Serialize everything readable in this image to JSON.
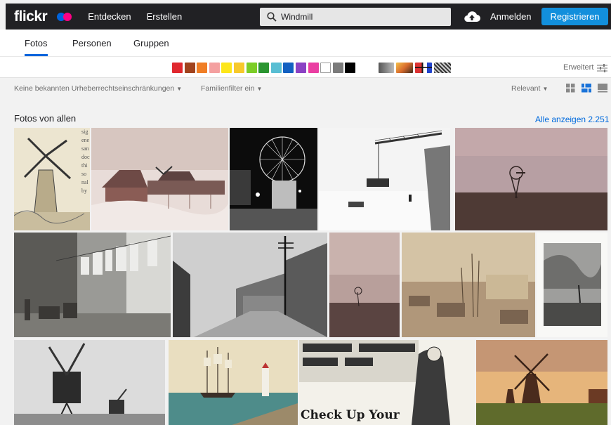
{
  "brand": {
    "logo": "flickr"
  },
  "nav": {
    "explore": "Entdecken",
    "create": "Erstellen"
  },
  "search": {
    "value": "Windmill"
  },
  "header": {
    "login": "Anmelden",
    "register": "Registrieren"
  },
  "tabs": [
    {
      "label": "Fotos",
      "active": true
    },
    {
      "label": "Personen",
      "active": false
    },
    {
      "label": "Gruppen",
      "active": false
    }
  ],
  "colors": [
    "#e0282f",
    "#a1431e",
    "#f07e26",
    "#f4a0a0",
    "#fde61a",
    "#f7c92b",
    "#7ccd27",
    "#2b9531",
    "#59bed3",
    "#1260c1",
    "#8b42c4",
    "#ea3ea2",
    "#ffffff",
    "#7b7b7b",
    "#000000"
  ],
  "styles": [
    "black-white-style-icon",
    "shallow-depth-style-icon",
    "minimalist-style-icon",
    "pattern-style-icon"
  ],
  "advanced": {
    "label": "Erweitert"
  },
  "filters": {
    "license": "Keine bekannten Urheberrechtseinschränkungen",
    "family": "Familienfilter ein",
    "sort": "Relevant"
  },
  "section": {
    "title": "Fotos von allen",
    "see_all": "Alle anzeigen 2.251"
  },
  "photos": [
    {
      "name": "photo-windmill-engraving",
      "description": "engraving of windmill with text"
    },
    {
      "name": "photo-winter-farm",
      "description": "snowy farm with windmill"
    },
    {
      "name": "photo-night-ferris-wheel",
      "description": "night long exposure"
    },
    {
      "name": "photo-crane-snow",
      "description": "crane over snow"
    },
    {
      "name": "photo-prairie-windmill",
      "description": "windmill on prairie"
    },
    {
      "name": "photo-laundry-alley",
      "description": "alley with laundry"
    },
    {
      "name": "photo-old-street",
      "description": "old street with buildings"
    },
    {
      "name": "photo-lone-windmill",
      "description": "lone windpump at dusk"
    },
    {
      "name": "photo-ruined-town",
      "description": "ruined town sepia"
    },
    {
      "name": "photo-storm-painting",
      "description": "stormy sea painting"
    },
    {
      "name": "photo-post-mill",
      "description": "post mills black and white"
    },
    {
      "name": "photo-harbor-sailship",
      "description": "harbor with sailing ship"
    },
    {
      "name": "photo-ad-check-up",
      "description": "vintage advertisement"
    },
    {
      "name": "photo-dutch-windmills",
      "description": "dutch windmills sunset"
    }
  ],
  "ad_text": {
    "line1": "Check Up Your"
  }
}
